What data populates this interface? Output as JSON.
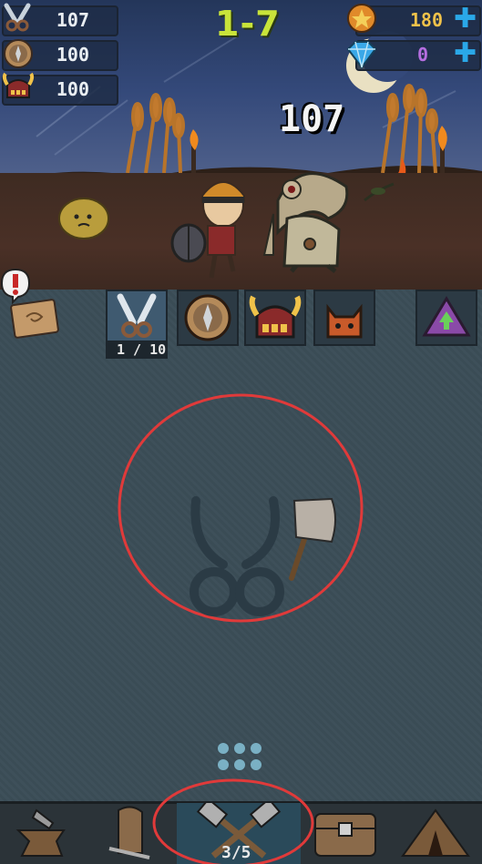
{
  "resources": {
    "attack": "107",
    "defense": "100",
    "helmet": "100",
    "coins": "180",
    "gems": "0"
  },
  "stage": "1-7",
  "enemy": {
    "hp": "107"
  },
  "slots": {
    "selected_count": "1 / 10"
  },
  "bottom": {
    "crafting_count": "3/5"
  },
  "colors": {
    "stage": "#c9e43a",
    "coins": "#f0c24a",
    "gems": "#b56ee0",
    "plus": "#2aa8e8",
    "highlight_ring": "#e03a3a"
  },
  "icons": [
    "swords-icon",
    "shield-icon",
    "helmet-icon",
    "coin-icon",
    "gem-icon",
    "plus-icon",
    "quest-book-icon",
    "cat-icon",
    "upgrade-arrow-icon",
    "axe-icon",
    "anvil-icon",
    "armor-icon",
    "crossed-axes-icon",
    "chest-icon",
    "tent-icon"
  ]
}
